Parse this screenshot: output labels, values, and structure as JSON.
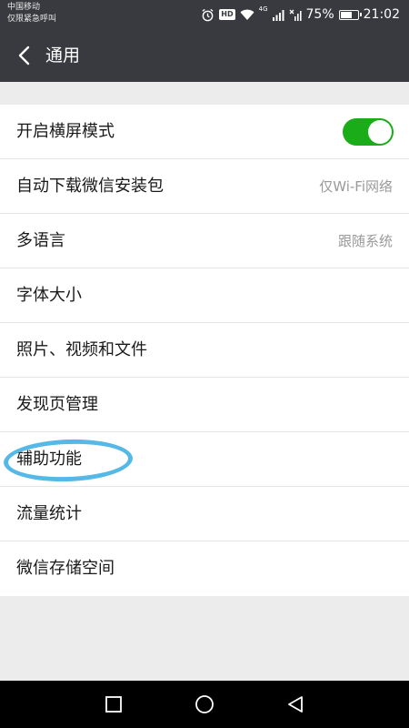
{
  "status_bar": {
    "carrier_line1": "中国移动",
    "carrier_line2": "仅限紧急呼叫",
    "network": "4G",
    "battery": "75%",
    "time": "21:02",
    "hd": "HD",
    "battery_level": 0.75,
    "icons": [
      "alarm-icon",
      "hd-icon",
      "wifi-icon",
      "signal-icon",
      "no-sim-signal-icon",
      "battery-icon"
    ]
  },
  "header": {
    "title": "通用",
    "back_icon": "chevron-left-icon"
  },
  "settings": {
    "items": [
      {
        "label": "开启横屏模式",
        "control": "toggle",
        "on": true
      },
      {
        "label": "自动下载微信安装包",
        "value": "仅Wi-Fi网络"
      },
      {
        "label": "多语言",
        "value": "跟随系统"
      },
      {
        "label": "字体大小"
      },
      {
        "label": "照片、视频和文件"
      },
      {
        "label": "发现页管理"
      },
      {
        "label": "辅助功能",
        "annotated": true
      },
      {
        "label": "流量统计"
      },
      {
        "label": "微信存储空间"
      }
    ]
  },
  "nav_bar": {
    "icons": [
      "recents-square-icon",
      "home-circle-icon",
      "back-triangle-icon"
    ]
  },
  "colors": {
    "header_bg": "#393a3f",
    "page_bg": "#ececec",
    "toggle_on": "#1aad19",
    "annotation": "#55b8e6"
  }
}
